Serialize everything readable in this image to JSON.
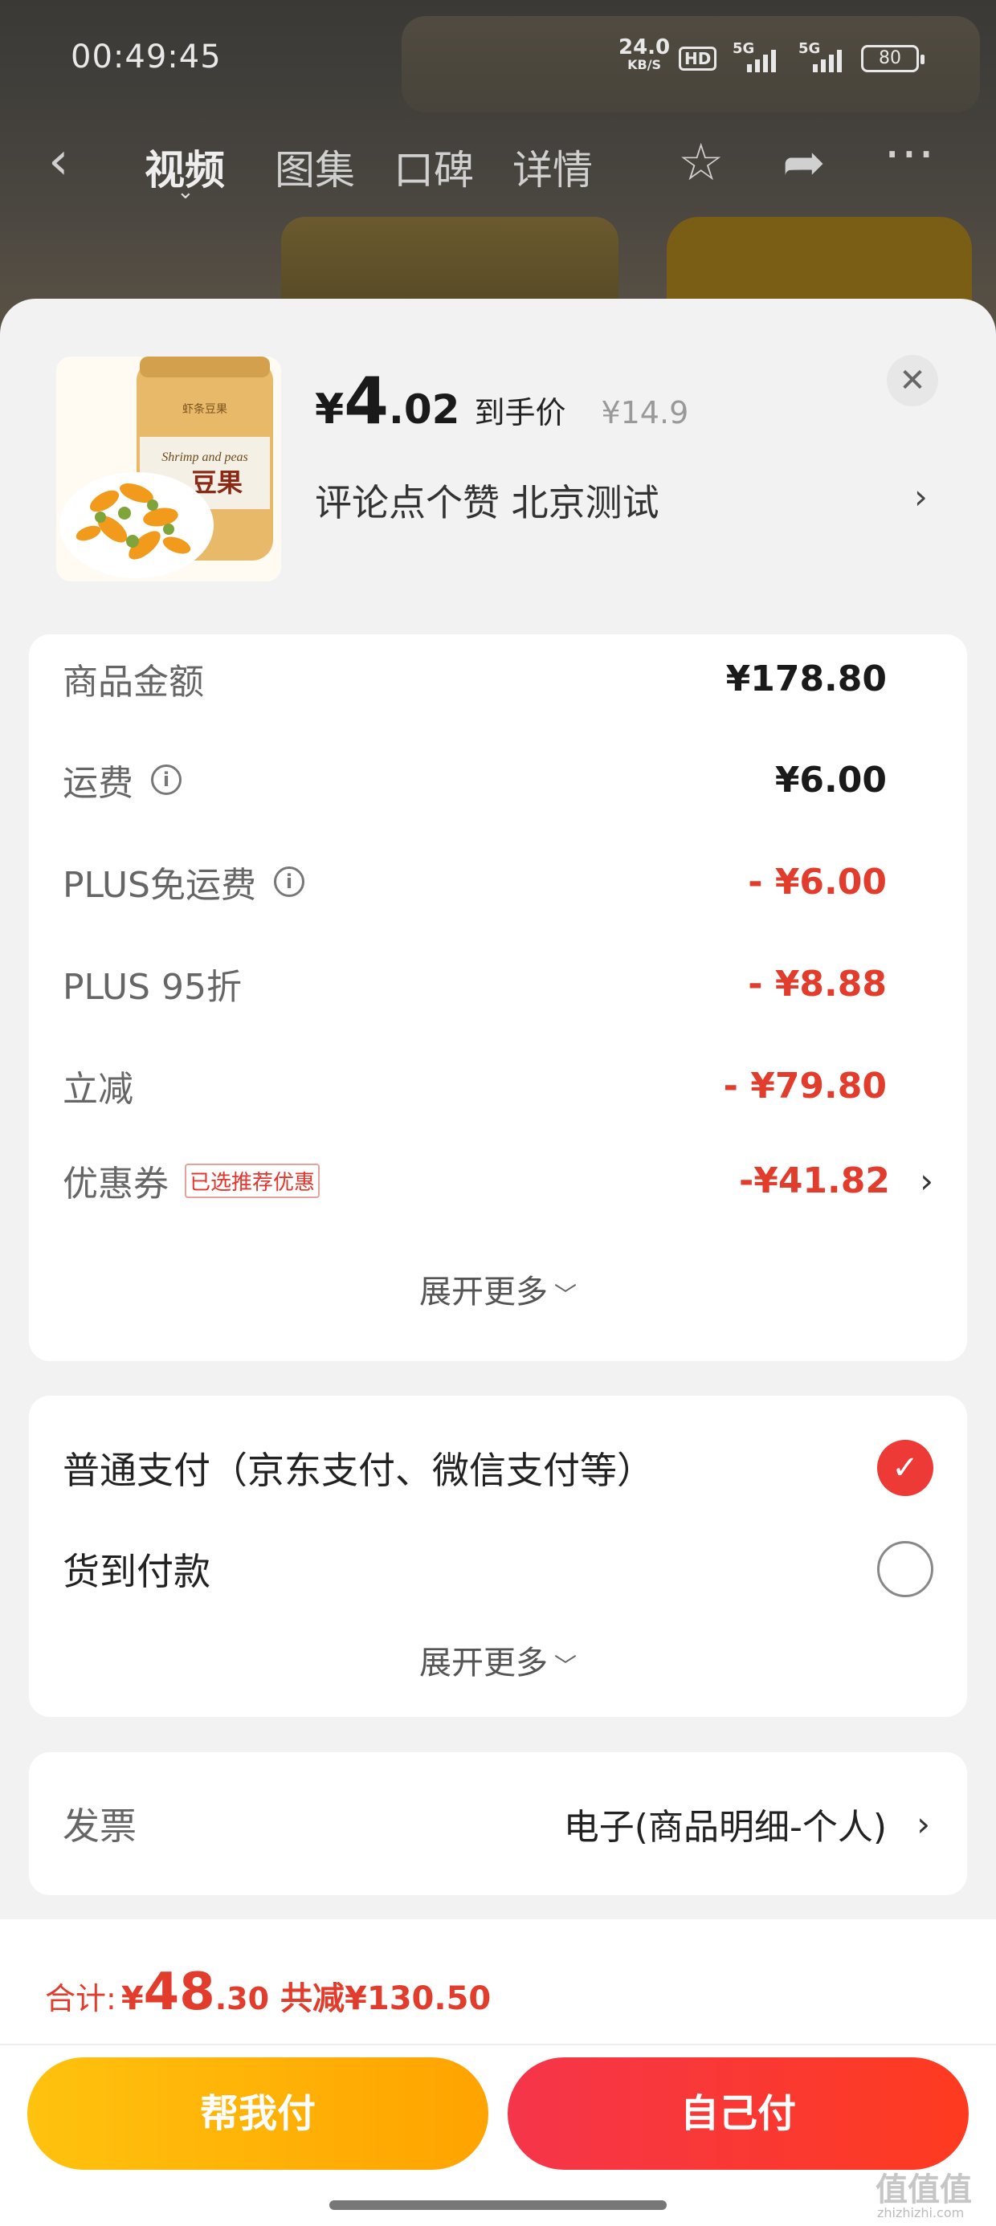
{
  "status_bar": {
    "time": "00:49:45",
    "net_speed_value": "24.0",
    "net_speed_unit": "KB/S",
    "hd_label": "HD",
    "sim1_label": "5G",
    "sim2_label": "5G",
    "battery": "80"
  },
  "top_nav": {
    "tabs": [
      "视频",
      "图集",
      "口碑",
      "详情"
    ],
    "active_tab": "视频",
    "back_icon": "chevron-left-icon",
    "icons": [
      "star-icon",
      "share-icon",
      "more-icon"
    ]
  },
  "product": {
    "price_currency": "¥",
    "price_integer": "4",
    "price_decimal": ".02",
    "price_tag": "到手价",
    "original_price": "¥14.9",
    "subtitle": "评论点个赞  北京测试",
    "thumb_caption_en": "Shrimp and peas",
    "thumb_caption_cn": "豆果",
    "thumb_top_text": "虾条豆果",
    "close_icon": "close-icon"
  },
  "summary": {
    "rows": [
      {
        "label": "商品金额",
        "value": "¥178.80",
        "red": false,
        "info": false
      },
      {
        "label": "运费",
        "value": "¥6.00",
        "red": false,
        "info": true
      },
      {
        "label": "PLUS免运费",
        "value": "- ¥6.00",
        "red": true,
        "info": true
      },
      {
        "label": "PLUS 95折",
        "value": "- ¥8.88",
        "red": true,
        "info": false
      },
      {
        "label": "立减",
        "value": "- ¥79.80",
        "red": true,
        "info": false
      },
      {
        "label": "优惠券",
        "value": "-¥41.82",
        "red": true,
        "info": false,
        "badge": "已选推荐优惠"
      }
    ],
    "expand_label": "展开更多"
  },
  "payment": {
    "options": [
      {
        "label": "普通支付（京东支付、微信支付等）",
        "selected": true
      },
      {
        "label": "货到付款",
        "selected": false
      }
    ],
    "expand_label": "展开更多"
  },
  "invoice": {
    "label": "发票",
    "value": "电子(商品明细-个人)"
  },
  "footer": {
    "total_label": "合计:",
    "total_currency": "¥",
    "total_integer": "48",
    "total_decimal": ".30",
    "savings": "共减¥130.50",
    "help_pay_label": "帮我付",
    "self_pay_label": "自己付"
  },
  "watermark": {
    "logo": "值值值",
    "site": "zhizhizhi.com"
  },
  "colors": {
    "accent_red": "#e23c2d",
    "button_yellow": "#ffb300",
    "button_red": "#f5354a"
  }
}
